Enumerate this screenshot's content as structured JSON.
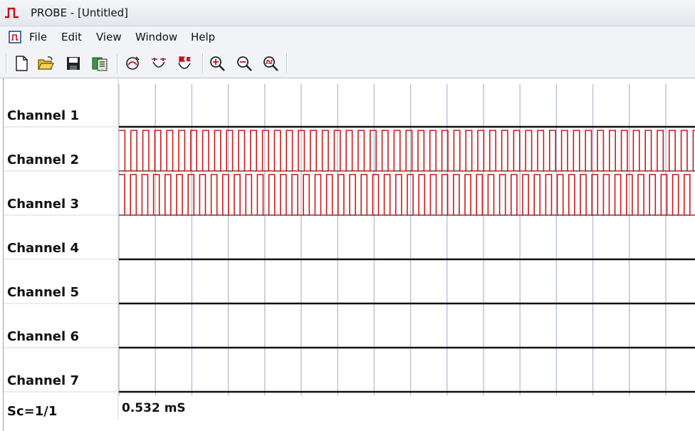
{
  "window": {
    "title": "PROBE - [Untitled]"
  },
  "menu": {
    "items": [
      "File",
      "Edit",
      "View",
      "Window",
      "Help"
    ]
  },
  "toolbar": {
    "buttons": [
      "new-icon",
      "open-icon",
      "save-icon",
      "export-icon",
      "probe-settings-icon",
      "measure-icon",
      "markers-icon",
      "zoom-in-icon",
      "zoom-out-icon",
      "zoom-fit-icon"
    ]
  },
  "channels": [
    {
      "label": "Channel 1",
      "signal": "low",
      "color": "#111111"
    },
    {
      "label": "Channel 2",
      "signal": "square",
      "color": "#cc1a1a"
    },
    {
      "label": "Channel 3",
      "signal": "square",
      "color": "#cc1a1a"
    },
    {
      "label": "Channel 4",
      "signal": "low",
      "color": "#111111"
    },
    {
      "label": "Channel 5",
      "signal": "low",
      "color": "#111111"
    },
    {
      "label": "Channel 6",
      "signal": "low",
      "color": "#111111"
    },
    {
      "label": "Channel 7",
      "signal": "low",
      "color": "#111111"
    }
  ],
  "status": {
    "scale": "Sc=1/1",
    "time": "0.532 mS"
  },
  "colors": {
    "grid": "#b9bfd8",
    "signal_active": "#cc1a1a",
    "signal_idle": "#111111"
  }
}
